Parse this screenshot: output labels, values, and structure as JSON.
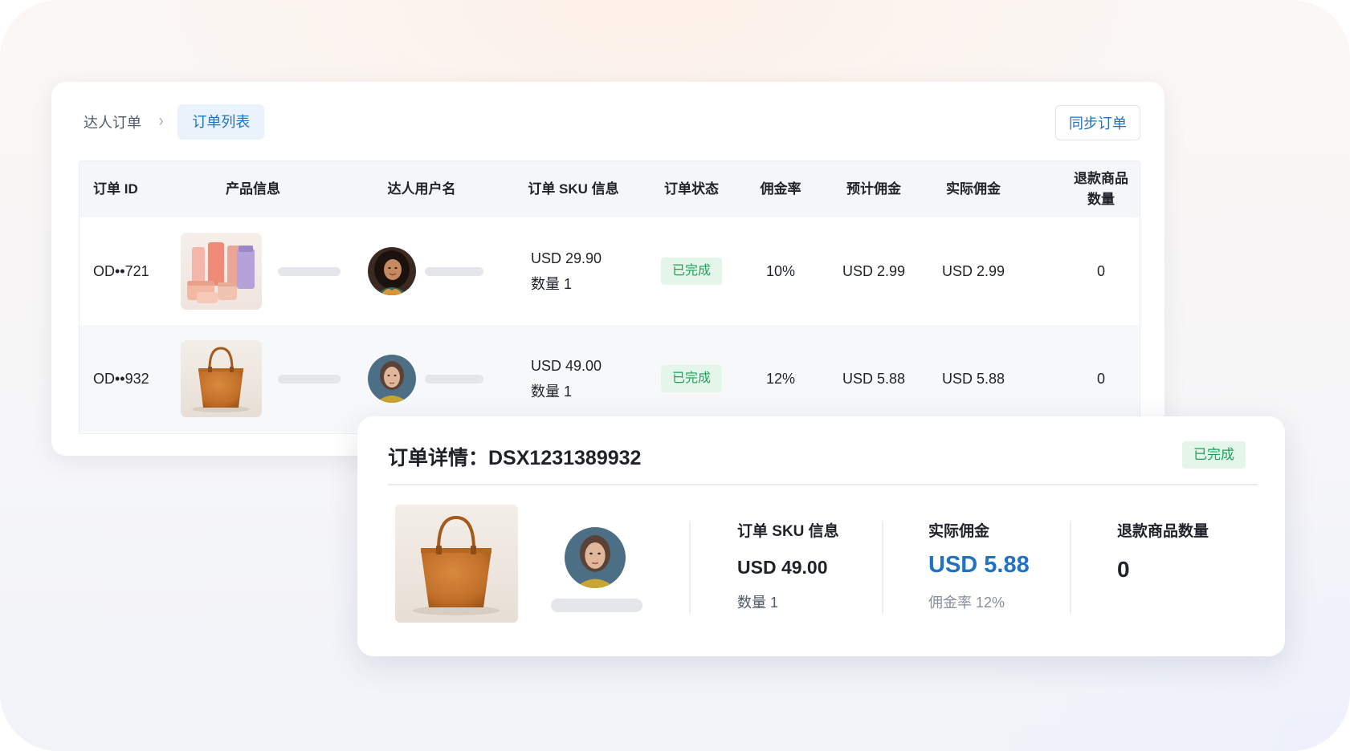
{
  "breadcrumb": {
    "parent": "达人订单",
    "separator": "›",
    "current": "订单列表"
  },
  "toolbar": {
    "sync_label": "同步订单"
  },
  "table": {
    "columns": [
      "订单 ID",
      "产品信息",
      "达人用户名",
      "订单 SKU 信息",
      "订单状态",
      "佣金率",
      "预计佣金",
      "实际佣金",
      "退款商品\n数量"
    ],
    "rows": [
      {
        "order_id": "OD••721",
        "product_image": "cosmetics-products-image",
        "creator_avatar": "creator-avatar-1",
        "sku_price": "USD 29.90",
        "sku_qty": "数量 1",
        "status": "已完成",
        "commission_rate": "10%",
        "est_commission": "USD 2.99",
        "actual_commission": "USD 2.99",
        "refund_qty": "0"
      },
      {
        "order_id": "OD••932",
        "product_image": "tote-bag-image",
        "creator_avatar": "creator-avatar-2",
        "sku_price": "USD 49.00",
        "sku_qty": "数量 1",
        "status": "已完成",
        "commission_rate": "12%",
        "est_commission": "USD 5.88",
        "actual_commission": "USD 5.88",
        "refund_qty": "0"
      }
    ]
  },
  "detail": {
    "title": "订单详情：DSX1231389932",
    "status": "已完成",
    "sku_label": "订单 SKU 信息",
    "sku_price": "USD 49.00",
    "sku_qty": "数量 1",
    "actual_label": "实际佣金",
    "actual_value": "USD 5.88",
    "rate_text": "佣金率 12%",
    "refund_label": "退款商品数量",
    "refund_value": "0"
  },
  "colors": {
    "accent": "#1f72c4",
    "accent_bg": "#eaf3fc",
    "success_text": "#1ea35b",
    "success_bg": "#e4f6ea",
    "header_bg": "#f4f6f9",
    "placeholder": "#e4e6ea"
  }
}
